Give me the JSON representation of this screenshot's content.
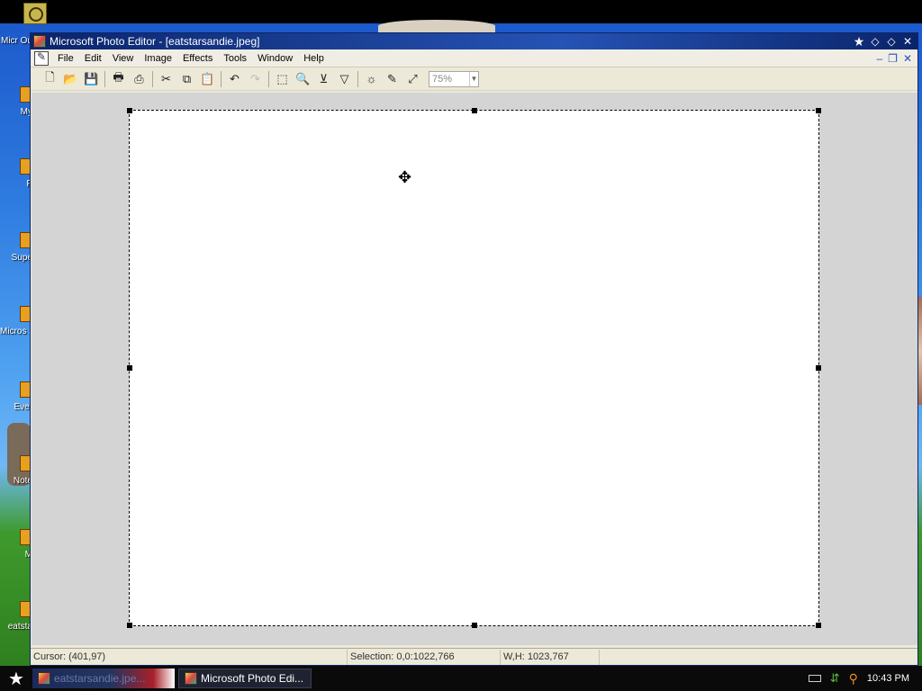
{
  "window": {
    "title": "Microsoft Photo Editor - [eatstarsandie.jpeg]",
    "title_buttons": [
      "★",
      "◇",
      "◇",
      "✕"
    ]
  },
  "menu": {
    "items": [
      "File",
      "Edit",
      "View",
      "Image",
      "Effects",
      "Tools",
      "Window",
      "Help"
    ],
    "mdi_buttons": [
      "–",
      "❐",
      "✕"
    ]
  },
  "toolbar": {
    "buttons": [
      {
        "name": "new-icon",
        "glyph": "🗋"
      },
      {
        "name": "open-icon",
        "glyph": "📂"
      },
      {
        "name": "save-icon",
        "glyph": "💾"
      },
      {
        "name": "print-icon",
        "glyph": "🖶"
      },
      {
        "name": "scan-icon",
        "glyph": "⎙"
      },
      {
        "name": "cut-icon",
        "glyph": "✂"
      },
      {
        "name": "copy-icon",
        "glyph": "⧉"
      },
      {
        "name": "paste-icon",
        "glyph": "📋"
      },
      {
        "name": "undo-icon",
        "glyph": "↶"
      },
      {
        "name": "redo-icon",
        "glyph": "↷"
      },
      {
        "name": "select-icon",
        "glyph": "⬚"
      },
      {
        "name": "zoom-icon",
        "glyph": "🔍"
      },
      {
        "name": "crop-icon",
        "glyph": "⊻"
      },
      {
        "name": "transparency-icon",
        "glyph": "▽"
      },
      {
        "name": "brightness-icon",
        "glyph": "☼"
      },
      {
        "name": "smudge-icon",
        "glyph": "✎"
      },
      {
        "name": "resize-icon",
        "glyph": "⤢"
      }
    ],
    "zoom_value": "75%"
  },
  "desktop": {
    "icons": [
      "Micr Ou",
      "My",
      "P",
      "Supe",
      "Micros Studi",
      "Ever",
      "Note",
      "M",
      "eatsta"
    ]
  },
  "status": {
    "cursor": "Cursor: (401,97)",
    "selection": "Selection: 0,0:1022,766",
    "size": "W,H: 1023,767"
  },
  "taskbar": {
    "start": "★",
    "tasks": [
      "eatstarsandie.jpe...",
      "Microsoft Photo Edi..."
    ],
    "clock": "10:43 PM"
  }
}
